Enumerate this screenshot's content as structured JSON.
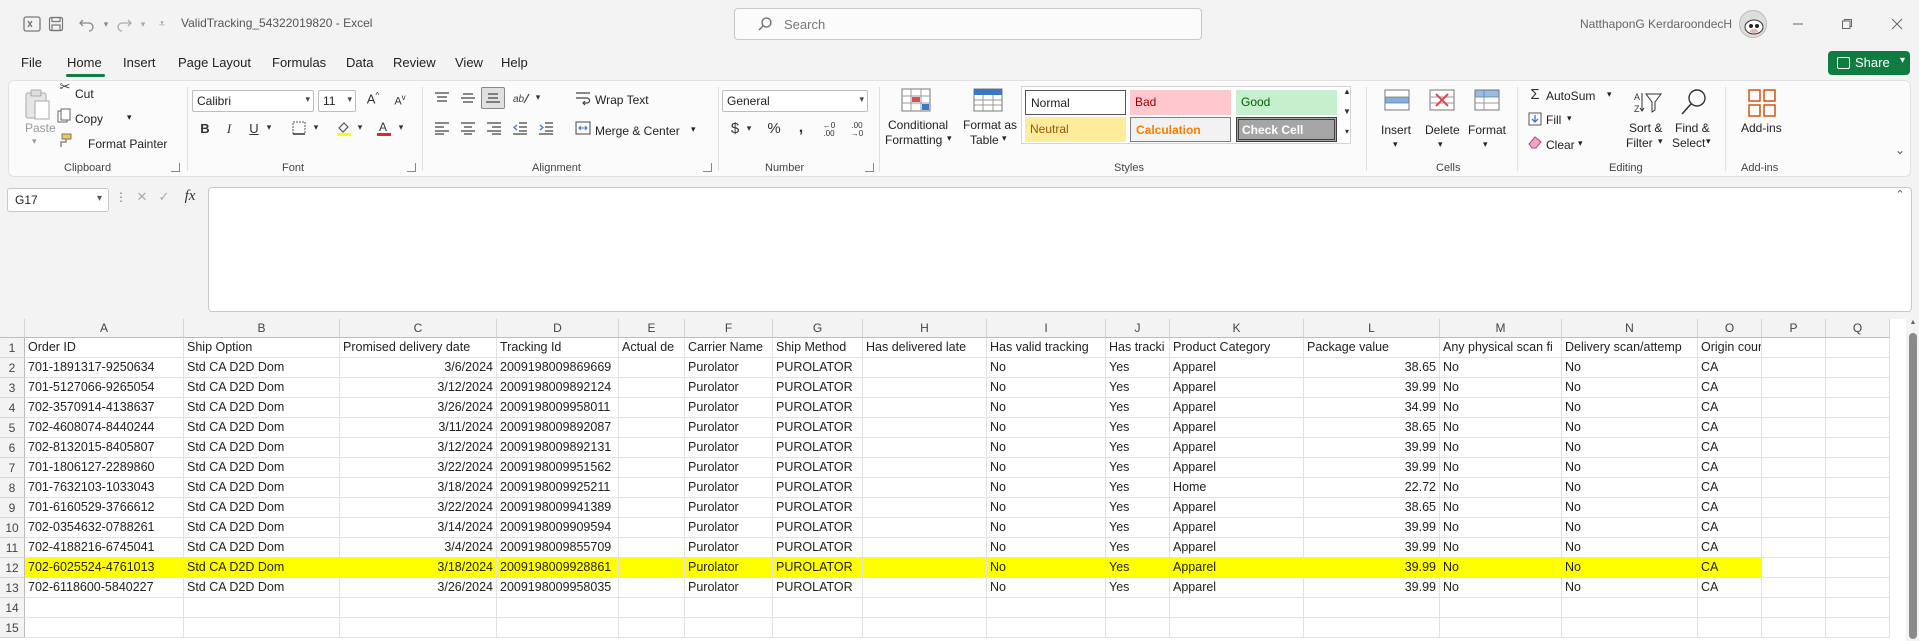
{
  "titlebar": {
    "title": "ValidTracking_54322019820  -  Excel",
    "search_placeholder": "Search",
    "user": "NatthaponG KerdaroondecH"
  },
  "menu": [
    "File",
    "Home",
    "Insert",
    "Page Layout",
    "Formulas",
    "Data",
    "Review",
    "View",
    "Help"
  ],
  "share_label": "Share",
  "ribbon": {
    "clipboard": {
      "paste": "Paste",
      "cut": "Cut",
      "copy": "Copy",
      "format_painter": "Format Painter",
      "group": "Clipboard"
    },
    "font": {
      "name": "Calibri",
      "size": "11",
      "group": "Font"
    },
    "alignment": {
      "wrap": "Wrap Text",
      "merge": "Merge & Center",
      "group": "Alignment"
    },
    "number": {
      "format": "General",
      "group": "Number"
    },
    "styles": {
      "conditional": "Conditional Formatting",
      "conditional_1": "Conditional",
      "conditional_2": "Formatting",
      "format_table_1": "Format as",
      "format_table_2": "Table",
      "normal": "Normal",
      "bad": "Bad",
      "good": "Good",
      "neutral": "Neutral",
      "calculation": "Calculation",
      "check": "Check Cell",
      "group": "Styles"
    },
    "cells": {
      "insert": "Insert",
      "delete": "Delete",
      "format": "Format",
      "group": "Cells"
    },
    "editing": {
      "autosum": "AutoSum",
      "fill": "Fill",
      "clear": "Clear",
      "sort_1": "Sort &",
      "sort_2": "Filter",
      "find_1": "Find &",
      "find_2": "Select",
      "group": "Editing"
    },
    "addins": {
      "label": "Add-ins",
      "group": "Add-ins"
    }
  },
  "formula": {
    "name_box": "G17",
    "fx": "fx"
  },
  "sheet": {
    "columns": [
      "A",
      "B",
      "C",
      "D",
      "E",
      "F",
      "G",
      "H",
      "I",
      "J",
      "K",
      "L",
      "M",
      "N",
      "O",
      "P",
      "Q"
    ],
    "row_numbers": [
      "1",
      "2",
      "3",
      "4",
      "5",
      "6",
      "7",
      "8",
      "9",
      "10",
      "11",
      "12",
      "13",
      "14",
      "15"
    ],
    "headers": [
      "Order ID",
      "Ship Option",
      "Promised delivery date",
      "Tracking Id",
      "Actual de",
      "Carrier Name",
      "Ship Method",
      "Has delivered late",
      "Has valid tracking",
      "Has tracki",
      "Product Category",
      "Package value",
      "Any physical scan fi",
      "Delivery scan/attemp",
      "Origin country",
      "",
      ""
    ],
    "highlight_row": 11,
    "rows": [
      [
        "701-1891317-9250634",
        "Std CA D2D Dom",
        "3/6/2024",
        "2009198009869669",
        "",
        "Purolator",
        "PUROLATOR",
        "",
        "No",
        "Yes",
        "Apparel",
        "38.65",
        "No",
        "No",
        "CA"
      ],
      [
        "701-5127066-9265054",
        "Std CA D2D Dom",
        "3/12/2024",
        "2009198009892124",
        "",
        "Purolator",
        "PUROLATOR",
        "",
        "No",
        "Yes",
        "Apparel",
        "39.99",
        "No",
        "No",
        "CA"
      ],
      [
        "702-3570914-4138637",
        "Std CA D2D Dom",
        "3/26/2024",
        "2009198009958011",
        "",
        "Purolator",
        "PUROLATOR",
        "",
        "No",
        "Yes",
        "Apparel",
        "34.99",
        "No",
        "No",
        "CA"
      ],
      [
        "702-4608074-8440244",
        "Std CA D2D Dom",
        "3/11/2024",
        "2009198009892087",
        "",
        "Purolator",
        "PUROLATOR",
        "",
        "No",
        "Yes",
        "Apparel",
        "38.65",
        "No",
        "No",
        "CA"
      ],
      [
        "702-8132015-8405807",
        "Std CA D2D Dom",
        "3/12/2024",
        "2009198009892131",
        "",
        "Purolator",
        "PUROLATOR",
        "",
        "No",
        "Yes",
        "Apparel",
        "39.99",
        "No",
        "No",
        "CA"
      ],
      [
        "701-1806127-2289860",
        "Std CA D2D Dom",
        "3/22/2024",
        "2009198009951562",
        "",
        "Purolator",
        "PUROLATOR",
        "",
        "No",
        "Yes",
        "Apparel",
        "39.99",
        "No",
        "No",
        "CA"
      ],
      [
        "701-7632103-1033043",
        "Std CA D2D Dom",
        "3/18/2024",
        "2009198009925211",
        "",
        "Purolator",
        "PUROLATOR",
        "",
        "No",
        "Yes",
        "Home",
        "22.72",
        "No",
        "No",
        "CA"
      ],
      [
        "701-6160529-3766612",
        "Std CA D2D Dom",
        "3/22/2024",
        "2009198009941389",
        "",
        "Purolator",
        "PUROLATOR",
        "",
        "No",
        "Yes",
        "Apparel",
        "38.65",
        "No",
        "No",
        "CA"
      ],
      [
        "702-0354632-0788261",
        "Std CA D2D Dom",
        "3/14/2024",
        "2009198009909594",
        "",
        "Purolator",
        "PUROLATOR",
        "",
        "No",
        "Yes",
        "Apparel",
        "39.99",
        "No",
        "No",
        "CA"
      ],
      [
        "702-4188216-6745041",
        "Std CA D2D Dom",
        "3/4/2024",
        "2009198009855709",
        "",
        "Purolator",
        "PUROLATOR",
        "",
        "No",
        "Yes",
        "Apparel",
        "39.99",
        "No",
        "No",
        "CA"
      ],
      [
        "702-6025524-4761013",
        "Std CA D2D Dom",
        "3/18/2024",
        "2009198009928861",
        "",
        "Purolator",
        "PUROLATOR",
        "",
        "No",
        "Yes",
        "Apparel",
        "39.99",
        "No",
        "No",
        "CA"
      ],
      [
        "702-6118600-5840227",
        "Std CA D2D Dom",
        "3/26/2024",
        "2009198009958035",
        "",
        "Purolator",
        "PUROLATOR",
        "",
        "No",
        "Yes",
        "Apparel",
        "39.99",
        "No",
        "No",
        "CA"
      ]
    ]
  },
  "colors": {
    "accent": "#107c41",
    "highlight": "#ffff00"
  }
}
